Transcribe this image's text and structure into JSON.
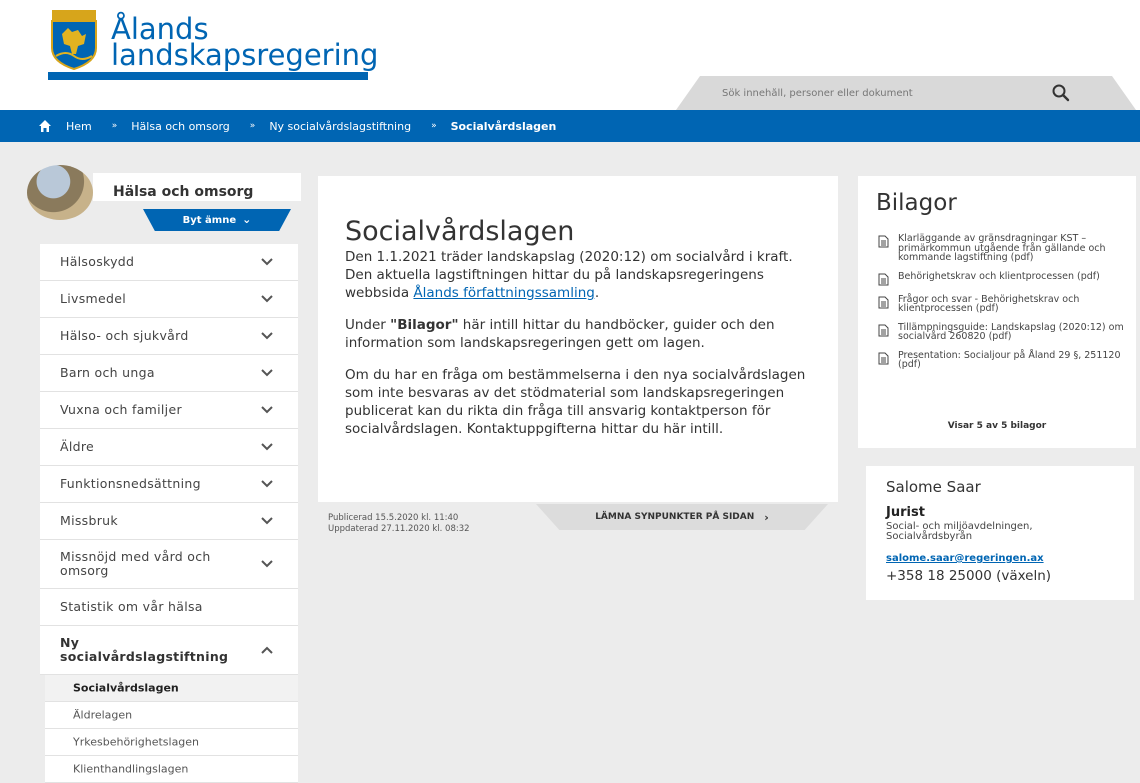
{
  "header": {
    "logo_line1": "Ålands",
    "logo_line2": "landskapsregering",
    "search_placeholder": "Sök innehåll, personer eller dokument",
    "brand_color": "#0065b3"
  },
  "breadcrumb": {
    "items": [
      "Hem",
      "Hälsa och omsorg",
      "Ny socialvårdslagstiftning"
    ],
    "current": "Socialvårdslagen",
    "separator": "»"
  },
  "sidebar": {
    "topic_title": "Hälsa och omsorg",
    "change_topic_label": "Byt ämne",
    "items": [
      {
        "label": "Hälsoskydd"
      },
      {
        "label": "Livsmedel"
      },
      {
        "label": "Hälso- och sjukvård"
      },
      {
        "label": "Barn och unga"
      },
      {
        "label": "Vuxna och familjer"
      },
      {
        "label": "Äldre"
      },
      {
        "label": "Funktionsnedsättning"
      },
      {
        "label": "Missbruk"
      },
      {
        "label": "Missnöjd med vård och omsorg"
      },
      {
        "label": "Statistik om vår hälsa"
      },
      {
        "label": "Ny socialvårdslagstiftning"
      }
    ],
    "subitems": [
      {
        "label": "Socialvårdslagen"
      },
      {
        "label": "Äldrelagen"
      },
      {
        "label": "Yrkesbehörighetslagen"
      },
      {
        "label": "Klienthandlingslagen"
      }
    ]
  },
  "main": {
    "title": "Socialvårdslagen",
    "p1_text": "Den 1.1.2021 träder landskapslag (2020:12) om socialvård i kraft. Den aktuella lagstiftningen hittar du på landskapsregeringens webbsida ",
    "p1_link": "Ålands författningssamling",
    "p1_end": ".",
    "p2_pre": "Under ",
    "p2_bold": "\"Bilagor\"",
    "p2_post": " här intill hittar du handböcker, guider och den information som landskapsregeringen gett om lagen.",
    "p3": "Om du har en fråga om bestämmelserna i den nya socialvårdslagen som inte besvaras av det stödmaterial som landskapsregeringen publicerat kan du rikta din fråga till ansvarig kontaktperson för socialvårdslagen. Kontaktuppgifterna hittar du här intill.",
    "published": "Publicerad 15.5.2020 kl. 11:40",
    "updated": "Uppdaterad 27.11.2020 kl. 08:32",
    "feedback_label": "LÄMNA SYNPUNKTER PÅ SIDAN"
  },
  "attachments": {
    "title": "Bilagor",
    "items": [
      {
        "label": "Klarläggande av gränsdragningar KST – primärkommun utgående från gällande och kommande lagstiftning (pdf)"
      },
      {
        "label": "Behörighetskrav och klientprocessen (pdf)"
      },
      {
        "label": "Frågor och svar - Behörighetskrav och klientprocessen (pdf)"
      },
      {
        "label": "Tillämpningsguide: Landskapslag (2020:12) om socialvård 260820 (pdf)"
      },
      {
        "label": "Presentation: Socialjour på Åland 29 §, 251120 (pdf)"
      }
    ],
    "count_label": "Visar 5 av 5 bilagor"
  },
  "contact": {
    "name": "Salome Saar",
    "role": "Jurist",
    "department": "Social- och miljöavdelningen, Socialvårdsbyrån",
    "email": "salome.saar@regeringen.ax",
    "phone": "+358 18 25000 (växeln)"
  }
}
